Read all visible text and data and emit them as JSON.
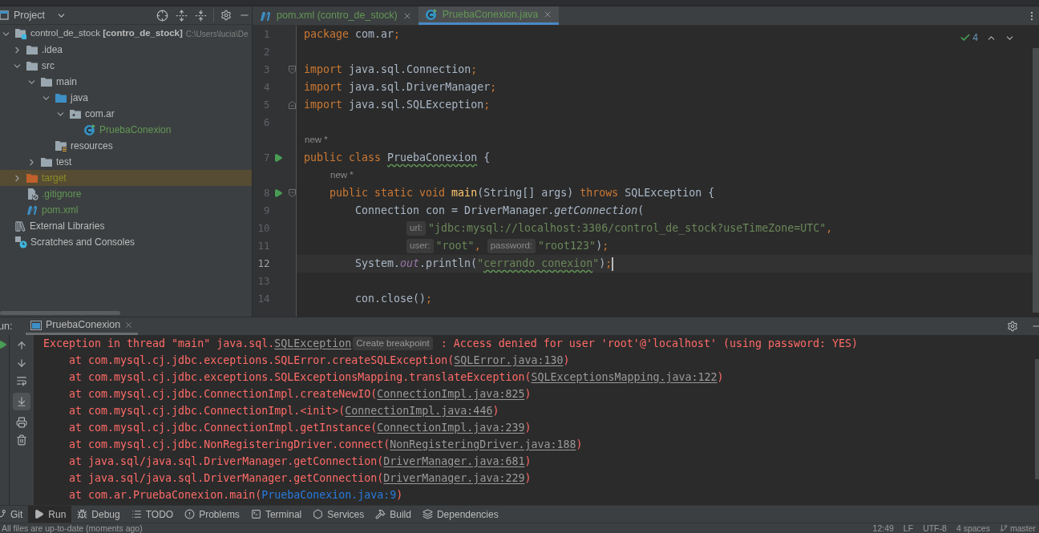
{
  "project_panel": {
    "title": "Project",
    "tree": [
      {
        "label": "control_de_stock **[contro_de_stock]**",
        "path": "C:\\Users\\lucia\\De",
        "kind": "module",
        "color": "#bbbbbb",
        "highlighted": false,
        "expanded": true,
        "children": [
          {
            "label": ".idea",
            "kind": "folder",
            "color": "#bbbbbb",
            "highlighted": false,
            "expanded": false
          },
          {
            "label": "src",
            "kind": "folder",
            "color": "#bbbbbb",
            "highlighted": false,
            "expanded": true,
            "children": [
              {
                "label": "main",
                "kind": "folder",
                "color": "#bbbbbb",
                "highlighted": false,
                "expanded": true,
                "children": [
                  {
                    "label": "java",
                    "kind": "source-folder",
                    "color": "#bbbbbb",
                    "highlighted": false,
                    "expanded": true,
                    "children": [
                      {
                        "label": "com.ar",
                        "kind": "package",
                        "color": "#bbbbbb",
                        "highlighted": false,
                        "expanded": true,
                        "children": [
                          {
                            "label": "PruebaConexion",
                            "kind": "java-class",
                            "color": "#629755",
                            "highlighted": false
                          }
                        ]
                      }
                    ]
                  },
                  {
                    "label": "resources",
                    "kind": "resources",
                    "color": "#bbbbbb",
                    "highlighted": false
                  }
                ]
              },
              {
                "label": "test",
                "kind": "folder",
                "color": "#bbbbbb",
                "highlighted": false,
                "expanded": false
              }
            ]
          },
          {
            "label": "target",
            "kind": "excluded-folder",
            "color": "#8c8c25",
            "highlighted": true,
            "expanded": false
          },
          {
            "label": ".gitignore",
            "kind": "ignore-file",
            "color": "#629755",
            "highlighted": false
          },
          {
            "label": "pom.xml",
            "kind": "maven",
            "color": "#629755",
            "highlighted": false
          }
        ]
      },
      {
        "label": "External Libraries",
        "kind": "libraries",
        "color": "#bbbbbb",
        "highlighted": false
      },
      {
        "label": "Scratches and Consoles",
        "kind": "scratches",
        "color": "#bbbbbb",
        "highlighted": false
      }
    ]
  },
  "editor": {
    "tabs": [
      {
        "label": "pom.xml (contro_de_stock)",
        "kind": "maven",
        "selected": false
      },
      {
        "label": "PruebaConexion.java",
        "kind": "java-class",
        "selected": true
      }
    ],
    "inspection_count": "4",
    "lines": [
      {
        "kind": "code",
        "number": "1",
        "current": false,
        "run": false,
        "fold_start": false,
        "fold_end": false,
        "tokens": [
          {
            "kind": "keyword",
            "text": "package "
          },
          {
            "kind": "plain",
            "text": "com.ar"
          },
          {
            "kind": "punct",
            "text": ";"
          }
        ]
      },
      {
        "kind": "code",
        "number": "2",
        "current": false,
        "run": false,
        "fold_start": false,
        "fold_end": false
      },
      {
        "kind": "code",
        "number": "3",
        "current": false,
        "run": false,
        "fold_start": true,
        "fold_end": false,
        "tokens": [
          {
            "kind": "keyword",
            "text": "import "
          },
          {
            "kind": "plain",
            "text": "java.sql.Connection"
          },
          {
            "kind": "punct",
            "text": ";"
          }
        ]
      },
      {
        "kind": "code",
        "number": "4",
        "current": false,
        "run": false,
        "fold_start": false,
        "fold_end": false,
        "tokens": [
          {
            "kind": "keyword",
            "text": "import "
          },
          {
            "kind": "plain",
            "text": "java.sql.DriverManager"
          },
          {
            "kind": "punct",
            "text": ";"
          }
        ]
      },
      {
        "kind": "code",
        "number": "5",
        "current": false,
        "run": false,
        "fold_start": false,
        "fold_end": true,
        "tokens": [
          {
            "kind": "keyword",
            "text": "import "
          },
          {
            "kind": "plain",
            "text": "java.sql.SQLException"
          },
          {
            "kind": "punct",
            "text": ";"
          }
        ]
      },
      {
        "kind": "code",
        "number": "6",
        "current": false,
        "run": false,
        "fold_start": false,
        "fold_end": false
      },
      {
        "kind": "hint",
        "text": "new *"
      },
      {
        "kind": "code",
        "number": "7",
        "current": false,
        "run": true,
        "fold_start": false,
        "fold_end": false,
        "tokens": [
          {
            "kind": "keyword",
            "text": "public class "
          },
          {
            "kind": "class-typo",
            "text": "PruebaConexion"
          },
          {
            "kind": "plain",
            "text": " {"
          }
        ],
        "children": [
          {
            "kind": "hint",
            "text": "new *"
          },
          {
            "kind": "code",
            "number": "8",
            "current": false,
            "run": true,
            "fold_start": true,
            "fold_end": false,
            "tokens": [
              {
                "kind": "keyword",
                "text": "public static void "
              },
              {
                "kind": "method",
                "text": "main"
              },
              {
                "kind": "plain",
                "text": "(String[] args) "
              },
              {
                "kind": "keyword",
                "text": "throws "
              },
              {
                "kind": "plain",
                "text": "SQLException {"
              }
            ],
            "children": [
              {
                "kind": "code",
                "number": "9",
                "current": false,
                "run": false,
                "fold_start": false,
                "fold_end": false,
                "tokens": [
                  {
                    "kind": "plain",
                    "text": "Connection con = DriverManager."
                  },
                  {
                    "kind": "italic",
                    "text": "getConnection"
                  },
                  {
                    "kind": "plain",
                    "text": "("
                  }
                ],
                "children": [
                  {
                    "kind": "continuation",
                    "number": "10",
                    "current": false,
                    "run": false,
                    "fold_start": false,
                    "fold_end": false,
                    "tokens": [
                      {
                        "kind": "inlay",
                        "text": "url:"
                      },
                      {
                        "kind": "string",
                        "text": "\"jdbc:mysql://localhost:3306/control_de_stock?useTimeZone=UTC\""
                      },
                      {
                        "kind": "punct",
                        "text": ","
                      }
                    ]
                  },
                  {
                    "kind": "continuation",
                    "number": "11",
                    "current": false,
                    "run": false,
                    "fold_start": false,
                    "fold_end": false,
                    "tokens": [
                      {
                        "kind": "inlay",
                        "text": "user:"
                      },
                      {
                        "kind": "string",
                        "text": "\"root\""
                      },
                      {
                        "kind": "punct",
                        "text": ", "
                      },
                      {
                        "kind": "inlay",
                        "text": "password:"
                      },
                      {
                        "kind": "string",
                        "text": "\"root123\""
                      },
                      {
                        "kind": "plain",
                        "text": ")"
                      },
                      {
                        "kind": "punct",
                        "text": ";"
                      }
                    ]
                  }
                ]
              },
              {
                "kind": "code",
                "number": "12",
                "current": true,
                "run": false,
                "fold_start": false,
                "fold_end": false,
                "tokens": [
                  {
                    "kind": "plain",
                    "text": "System."
                  },
                  {
                    "kind": "field",
                    "text": "out"
                  },
                  {
                    "kind": "plain",
                    "text": ".println("
                  },
                  {
                    "kind": "string",
                    "text": "\""
                  },
                  {
                    "kind": "string-typo",
                    "text": "cerrando conexion"
                  },
                  {
                    "kind": "string",
                    "text": "\""
                  },
                  {
                    "kind": "plain",
                    "text": ")"
                  },
                  {
                    "kind": "punct",
                    "text": ";"
                  }
                ]
              },
              {
                "kind": "code",
                "number": "13",
                "current": false,
                "run": false,
                "fold_start": false,
                "fold_end": false
              },
              {
                "kind": "code",
                "number": "14",
                "current": false,
                "run": false,
                "fold_start": false,
                "fold_end": false,
                "tokens": [
                  {
                    "kind": "plain",
                    "text": "con.close()"
                  },
                  {
                    "kind": "punct",
                    "text": ";"
                  }
                ]
              }
            ]
          }
        ]
      }
    ]
  },
  "run_panel": {
    "label": "un:",
    "tab": "PruebaConexion",
    "console": [
      [
        {
          "kind": "error",
          "text": "Exception in thread \"main\" java.sql."
        },
        {
          "kind": "link",
          "text": "SQLException"
        },
        {
          "kind": "hint",
          "text": "Create breakpoint"
        },
        {
          "kind": "error",
          "text": " : Access denied for user 'root'@'localhost' (using password: YES)"
        }
      ],
      [
        {
          "kind": "error",
          "text": "    at com.mysql.cj.jdbc.exceptions.SQLError.createSQLException("
        },
        {
          "kind": "link",
          "text": "SQLError.java:130"
        },
        {
          "kind": "error",
          "text": ")"
        }
      ],
      [
        {
          "kind": "error",
          "text": "    at com.mysql.cj.jdbc.exceptions.SQLExceptionsMapping.translateException("
        },
        {
          "kind": "link",
          "text": "SQLExceptionsMapping.java:122"
        },
        {
          "kind": "error",
          "text": ")"
        }
      ],
      [
        {
          "kind": "error",
          "text": "    at com.mysql.cj.jdbc.ConnectionImpl.createNewIO("
        },
        {
          "kind": "link",
          "text": "ConnectionImpl.java:825"
        },
        {
          "kind": "error",
          "text": ")"
        }
      ],
      [
        {
          "kind": "error",
          "text": "    at com.mysql.cj.jdbc.ConnectionImpl.<init>("
        },
        {
          "kind": "link",
          "text": "ConnectionImpl.java:446"
        },
        {
          "kind": "error",
          "text": ")"
        }
      ],
      [
        {
          "kind": "error",
          "text": "    at com.mysql.cj.jdbc.ConnectionImpl.getInstance("
        },
        {
          "kind": "link",
          "text": "ConnectionImpl.java:239"
        },
        {
          "kind": "error",
          "text": ")"
        }
      ],
      [
        {
          "kind": "error",
          "text": "    at com.mysql.cj.jdbc.NonRegisteringDriver.connect("
        },
        {
          "kind": "link",
          "text": "NonRegisteringDriver.java:188"
        },
        {
          "kind": "error",
          "text": ")"
        }
      ],
      [
        {
          "kind": "error",
          "text": "    at java.sql/java.sql.DriverManager.getConnection("
        },
        {
          "kind": "link",
          "text": "DriverManager.java:681"
        },
        {
          "kind": "error",
          "text": ")"
        }
      ],
      [
        {
          "kind": "error",
          "text": "    at java.sql/java.sql.DriverManager.getConnection("
        },
        {
          "kind": "link",
          "text": "DriverManager.java:229"
        },
        {
          "kind": "error",
          "text": ")"
        }
      ],
      [
        {
          "kind": "error",
          "text": "    at com.ar.PruebaConexion.main("
        },
        {
          "kind": "source-link",
          "text": "PruebaConexion.java:9"
        },
        {
          "kind": "error",
          "text": ")"
        }
      ]
    ]
  },
  "tool_windows": [
    {
      "label": "Git",
      "kind": "git",
      "selected": false
    },
    {
      "label": "Run",
      "kind": "run",
      "selected": true
    },
    {
      "label": "Debug",
      "kind": "debug",
      "selected": false
    },
    {
      "label": "TODO",
      "kind": "todo",
      "selected": false
    },
    {
      "label": "Problems",
      "kind": "problems",
      "selected": false
    },
    {
      "label": "Terminal",
      "kind": "terminal",
      "selected": false
    },
    {
      "label": "Services",
      "kind": "services",
      "selected": false
    },
    {
      "label": "Build",
      "kind": "build",
      "selected": false
    },
    {
      "label": "Dependencies",
      "kind": "dependencies",
      "selected": false
    }
  ],
  "status_bar": {
    "message": "All files are up-to-date (moments ago)",
    "items": [
      "12:49",
      "LF",
      "UTF-8",
      "4 spaces"
    ],
    "branch": "master"
  }
}
